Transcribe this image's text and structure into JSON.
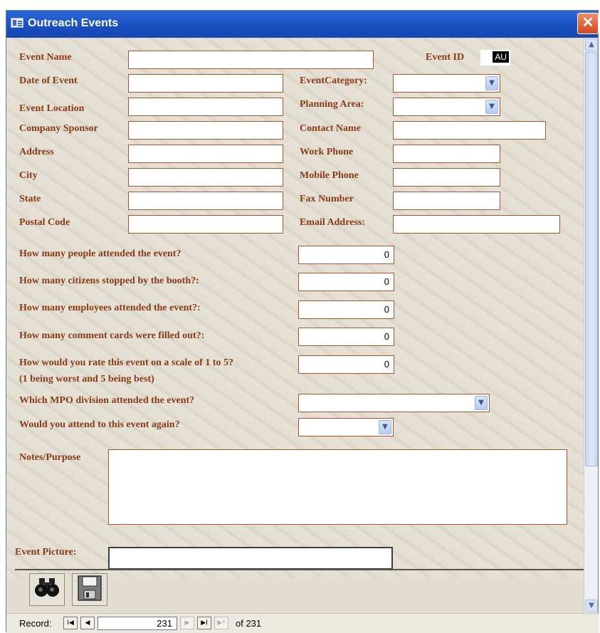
{
  "window": {
    "title": "Outreach Events",
    "close": "✕"
  },
  "fields": {
    "event_name": "Event Name",
    "event_id": "Event ID",
    "event_id_value": "AU",
    "date_of_event": "Date of Event",
    "event_category": "EventCategory:",
    "event_location": "Event Location",
    "planning_area": "Planning Area:",
    "company_sponsor": "Company Sponsor",
    "contact_name": "Contact Name",
    "address": "Address",
    "work_phone": "Work Phone",
    "city": "City",
    "mobile_phone": "Mobile Phone",
    "state": "State",
    "fax_number": "Fax Number",
    "postal_code": "Postal Code",
    "email_address": "Email Address:"
  },
  "questions": {
    "people_attended": "How many people attended the event?",
    "people_attended_value": "0",
    "citizens_stopped": "How many citizens stopped by the booth?:",
    "citizens_stopped_value": "0",
    "employees_attended": "How many employees attended the event?:",
    "employees_attended_value": "0",
    "comment_cards": "How many comment cards were filled out?:",
    "comment_cards_value": "0",
    "rating": "How would you rate this event on a scale of 1 to 5?",
    "rating_note": "(1 being worst and 5 being best)",
    "rating_value": "0",
    "mpo_division": "Which MPO division attended the event?",
    "attend_again": "Would you attend to this event again?"
  },
  "notes_label": "Notes/Purpose",
  "picture_label": "Event Picture:",
  "toolbar": {
    "find_icon": "binoculars-icon",
    "save_icon": "floppy-disk-icon"
  },
  "navigation": {
    "record_label": "Record:",
    "first": "I◀",
    "prev": "◀",
    "current": "231",
    "next": "▶",
    "last": "▶I",
    "new": "▶*",
    "of_label": "of 231"
  },
  "colors": {
    "label": "#8a3a16",
    "field_border": "#a5572c",
    "titlebar": "#1b4fc0"
  }
}
